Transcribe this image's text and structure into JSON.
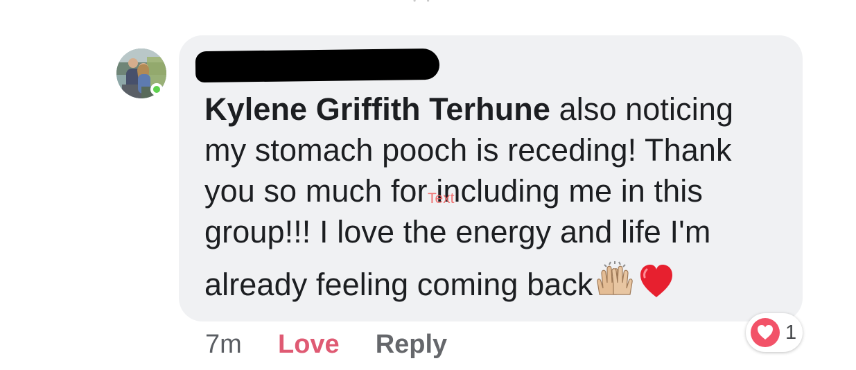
{
  "comment": {
    "author_name": "",
    "tagged_person": "Kylene Griffith Terhune",
    "text_line_1": " also noticing",
    "text_line_2": "my stomach pooch is receding! Thank",
    "text_line_3": "you so much for including me in this",
    "text_line_4": "group!!! I love the energy and life I'm",
    "text_line_5": "already feeling coming back",
    "emojis": [
      "raising-hands-emoji",
      "red-heart-emoji"
    ]
  },
  "annotation": {
    "label": "Text"
  },
  "actions": {
    "timestamp": "7m",
    "love_label": "Love",
    "reply_label": "Reply"
  },
  "reaction": {
    "type": "heart",
    "count": "1"
  },
  "colors": {
    "bubble": "#f0f1f3",
    "love": "#df5a73",
    "reaction_heart": "#f25268",
    "online": "#5fd14f"
  }
}
